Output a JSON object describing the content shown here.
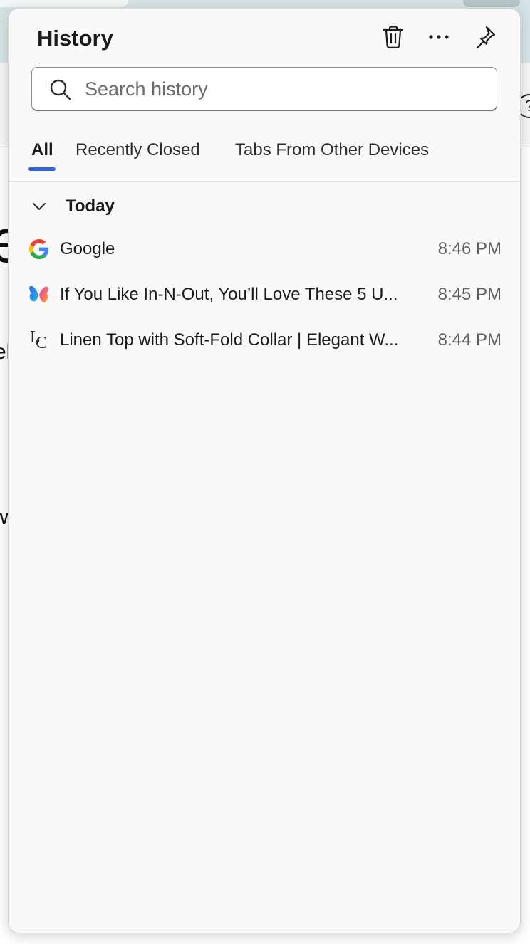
{
  "panel": {
    "title": "History",
    "actions": {
      "delete": "trash-icon",
      "more": "more-options-icon",
      "pin": "pin-icon"
    }
  },
  "search": {
    "placeholder": "Search history",
    "value": ""
  },
  "tabs": [
    {
      "label": "All",
      "selected": true
    },
    {
      "label": "Recently Closed",
      "selected": false
    },
    {
      "label": "Tabs From Other Devices",
      "selected": false
    }
  ],
  "groups": [
    {
      "label": "Today",
      "expanded": true,
      "items": [
        {
          "title": "Google",
          "time": "8:46 PM",
          "favicon": "google-icon"
        },
        {
          "title": "If You Like In-N-Out, You’ll Love These 5 U...",
          "time": "8:45 PM",
          "favicon": "butterfly-icon"
        },
        {
          "title": "Linen Top with Soft-Fold Collar | Elegant W...",
          "time": "8:44 PM",
          "favicon": "lc-logo-icon",
          "favicon_text": "LC"
        }
      ]
    }
  ],
  "background": {
    "help_glyph": "?"
  },
  "colors": {
    "accent": "#2f62d8",
    "panel_bg": "#f9f9f9",
    "tab_strip": "#d7e4e6"
  }
}
